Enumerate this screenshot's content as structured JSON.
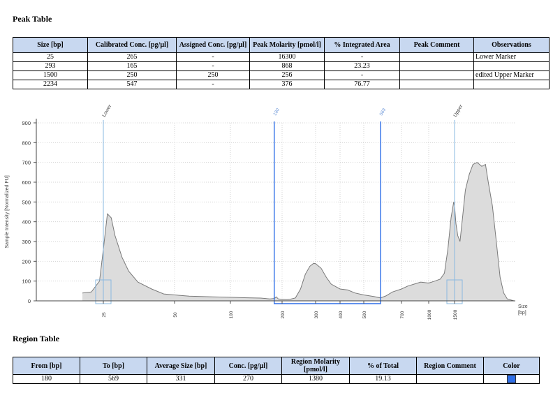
{
  "peak_table": {
    "title": "Peak Table",
    "headers": [
      "Size [bp]",
      "Calibrated Conc. [pg/µl]",
      "Assigned Conc. [pg/µl]",
      "Peak Molarity [pmol/l]",
      "% Integrated Area",
      "Peak Comment",
      "Observations"
    ],
    "rows": [
      [
        "25",
        "265",
        "-",
        "16300",
        "-",
        "",
        "Lower Marker"
      ],
      [
        "293",
        "165",
        "-",
        "868",
        "23.23",
        "",
        ""
      ],
      [
        "1500",
        "250",
        "250",
        "256",
        "-",
        "",
        "edited Upper Marker"
      ],
      [
        "2234",
        "547",
        "-",
        "376",
        "76.77",
        "",
        ""
      ]
    ]
  },
  "region_table": {
    "title": "Region Table",
    "headers": [
      "From [bp]",
      "To [bp]",
      "Average Size [bp]",
      "Conc. [pg/µl]",
      "Region Molarity [pmol/l]",
      "% of Total",
      "Region Comment",
      "Color"
    ],
    "rows": [
      [
        "180",
        "569",
        "331",
        "270",
        "1380",
        "19.13",
        "",
        ""
      ]
    ],
    "swatch_color": "#2f6fe8"
  },
  "chart_data": {
    "type": "area",
    "ylabel": "Sample Intensity [Normalized FU]",
    "xlabel": "Size [bp]",
    "ylim": [
      0,
      900
    ],
    "yticks": [
      0,
      100,
      200,
      300,
      400,
      500,
      600,
      700,
      800,
      900
    ],
    "xticks": [
      "25",
      "50",
      "100",
      "200",
      "300",
      "400",
      "500",
      "700",
      "1000",
      "1500"
    ],
    "markers": [
      {
        "label": "Lower",
        "size": 25
      },
      {
        "label": "Upper",
        "size": 1500
      }
    ],
    "region": {
      "from_label": "180",
      "to_label": "569",
      "from": 180,
      "to": 569,
      "color": "#2f6fe8"
    },
    "fill_color": "#dcdcdc",
    "line_color": "#7a7a7a",
    "marker_color": "#8ab8e0",
    "trace": {
      "size": [
        20,
        22,
        24,
        25,
        26,
        27,
        28,
        30,
        32,
        35,
        40,
        45,
        50,
        60,
        80,
        100,
        120,
        150,
        170,
        180,
        185,
        190,
        200,
        210,
        220,
        235,
        250,
        265,
        280,
        293,
        300,
        320,
        340,
        360,
        380,
        400,
        430,
        460,
        500,
        540,
        569,
        600,
        640,
        700,
        760,
        830,
        900,
        1000,
        1100,
        1200,
        1280,
        1350,
        1420,
        1480,
        1500,
        1530,
        1570,
        1620,
        1680,
        1750,
        1850,
        1950,
        2050,
        2150,
        2234,
        2300,
        2400,
        2500,
        2600,
        2700,
        2800,
        2900,
        3000
      ],
      "fu": [
        40,
        45,
        100,
        260,
        440,
        420,
        330,
        220,
        150,
        95,
        60,
        35,
        30,
        24,
        20,
        18,
        16,
        14,
        10,
        12,
        20,
        10,
        8,
        6,
        8,
        15,
        60,
        135,
        175,
        190,
        188,
        165,
        120,
        85,
        72,
        60,
        55,
        40,
        30,
        22,
        15,
        25,
        45,
        60,
        75,
        85,
        95,
        90,
        100,
        110,
        140,
        260,
        420,
        500,
        480,
        390,
        330,
        300,
        420,
        560,
        640,
        690,
        700,
        680,
        690,
        600,
        480,
        300,
        120,
        40,
        10,
        5,
        0
      ]
    }
  }
}
